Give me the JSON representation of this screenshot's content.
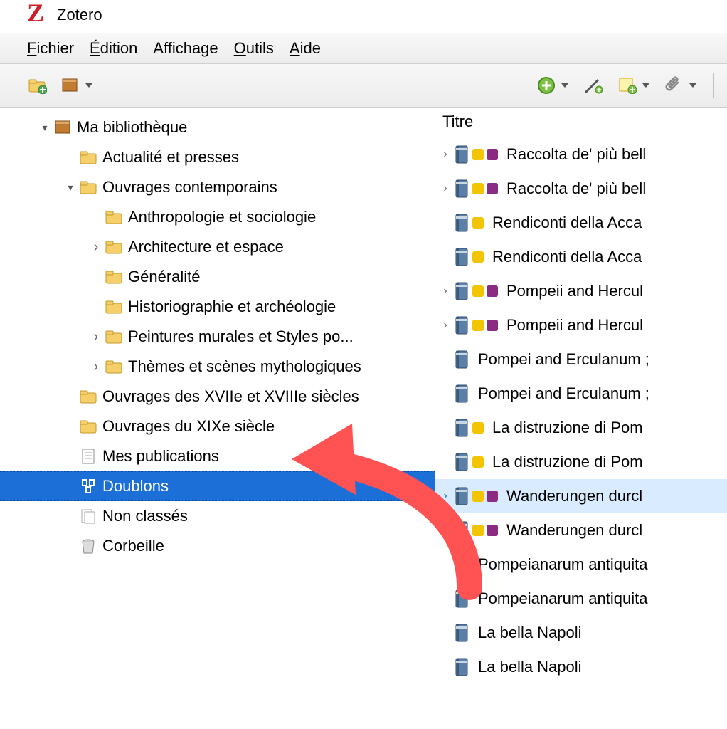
{
  "app": {
    "title": "Zotero",
    "logo_letter": "Z"
  },
  "menu": {
    "fichier": "Fichier",
    "edition": "Édition",
    "affichage": "Affichage",
    "outils": "Outils",
    "aide": "Aide"
  },
  "sidebar": {
    "library_label": "Ma bibliothèque",
    "items": [
      {
        "label": "Actualité et presses",
        "type": "folder",
        "indent": 1,
        "twisty": ""
      },
      {
        "label": "Ouvrages contemporains",
        "type": "folder",
        "indent": 1,
        "twisty": "open"
      },
      {
        "label": "Anthropologie et sociologie",
        "type": "folder",
        "indent": 2,
        "twisty": ""
      },
      {
        "label": "Architecture et espace",
        "type": "folder",
        "indent": 2,
        "twisty": "closed"
      },
      {
        "label": "Généralité",
        "type": "folder",
        "indent": 2,
        "twisty": ""
      },
      {
        "label": "Historiographie et archéologie",
        "type": "folder",
        "indent": 2,
        "twisty": ""
      },
      {
        "label": "Peintures murales et Styles po...",
        "type": "folder",
        "indent": 2,
        "twisty": "closed"
      },
      {
        "label": "Thèmes et scènes mythologiques",
        "type": "folder",
        "indent": 2,
        "twisty": "closed"
      },
      {
        "label": "Ouvrages des XVIIe et XVIIIe siècles",
        "type": "folder",
        "indent": 1,
        "twisty": ""
      },
      {
        "label": "Ouvrages du XIXe siècle",
        "type": "folder",
        "indent": 1,
        "twisty": ""
      },
      {
        "label": "Mes publications",
        "type": "publications",
        "indent": 1,
        "twisty": ""
      },
      {
        "label": "Doublons",
        "type": "duplicates",
        "indent": 1,
        "twisty": "",
        "selected": true
      },
      {
        "label": "Non classés",
        "type": "unfiled",
        "indent": 1,
        "twisty": ""
      },
      {
        "label": "Corbeille",
        "type": "trash",
        "indent": 1,
        "twisty": ""
      }
    ]
  },
  "list": {
    "column_title": "Titre",
    "items": [
      {
        "expand": true,
        "tags": [
          "yellow",
          "purple"
        ],
        "title": "Raccolta de' più bell"
      },
      {
        "expand": true,
        "tags": [
          "yellow",
          "purple"
        ],
        "title": "Raccolta de' più bell"
      },
      {
        "expand": false,
        "tags": [
          "yellow"
        ],
        "title": "Rendiconti della Acca"
      },
      {
        "expand": false,
        "tags": [
          "yellow"
        ],
        "title": "Rendiconti della Acca"
      },
      {
        "expand": true,
        "tags": [
          "yellow",
          "purple"
        ],
        "title": "Pompeii and Hercul"
      },
      {
        "expand": true,
        "tags": [
          "yellow",
          "purple"
        ],
        "title": "Pompeii and Hercul"
      },
      {
        "expand": false,
        "tags": [],
        "title": "Pompei and Erculanum ;"
      },
      {
        "expand": false,
        "tags": [],
        "title": "Pompei and Erculanum ;"
      },
      {
        "expand": false,
        "tags": [
          "yellow"
        ],
        "title": "La distruzione di Pom"
      },
      {
        "expand": false,
        "tags": [
          "yellow"
        ],
        "title": "La distruzione di Pom"
      },
      {
        "expand": true,
        "tags": [
          "yellow",
          "purple"
        ],
        "title": "Wanderungen durcl",
        "highlight": true
      },
      {
        "expand": false,
        "tags": [
          "yellow",
          "purple"
        ],
        "title": "Wanderungen durcl"
      },
      {
        "expand": false,
        "tags": [],
        "title": "Pompeianarum antiquita"
      },
      {
        "expand": false,
        "tags": [],
        "title": "Pompeianarum antiquita"
      },
      {
        "expand": false,
        "tags": [],
        "title": "La bella Napoli"
      },
      {
        "expand": false,
        "tags": [],
        "title": "La bella Napoli"
      }
    ]
  }
}
